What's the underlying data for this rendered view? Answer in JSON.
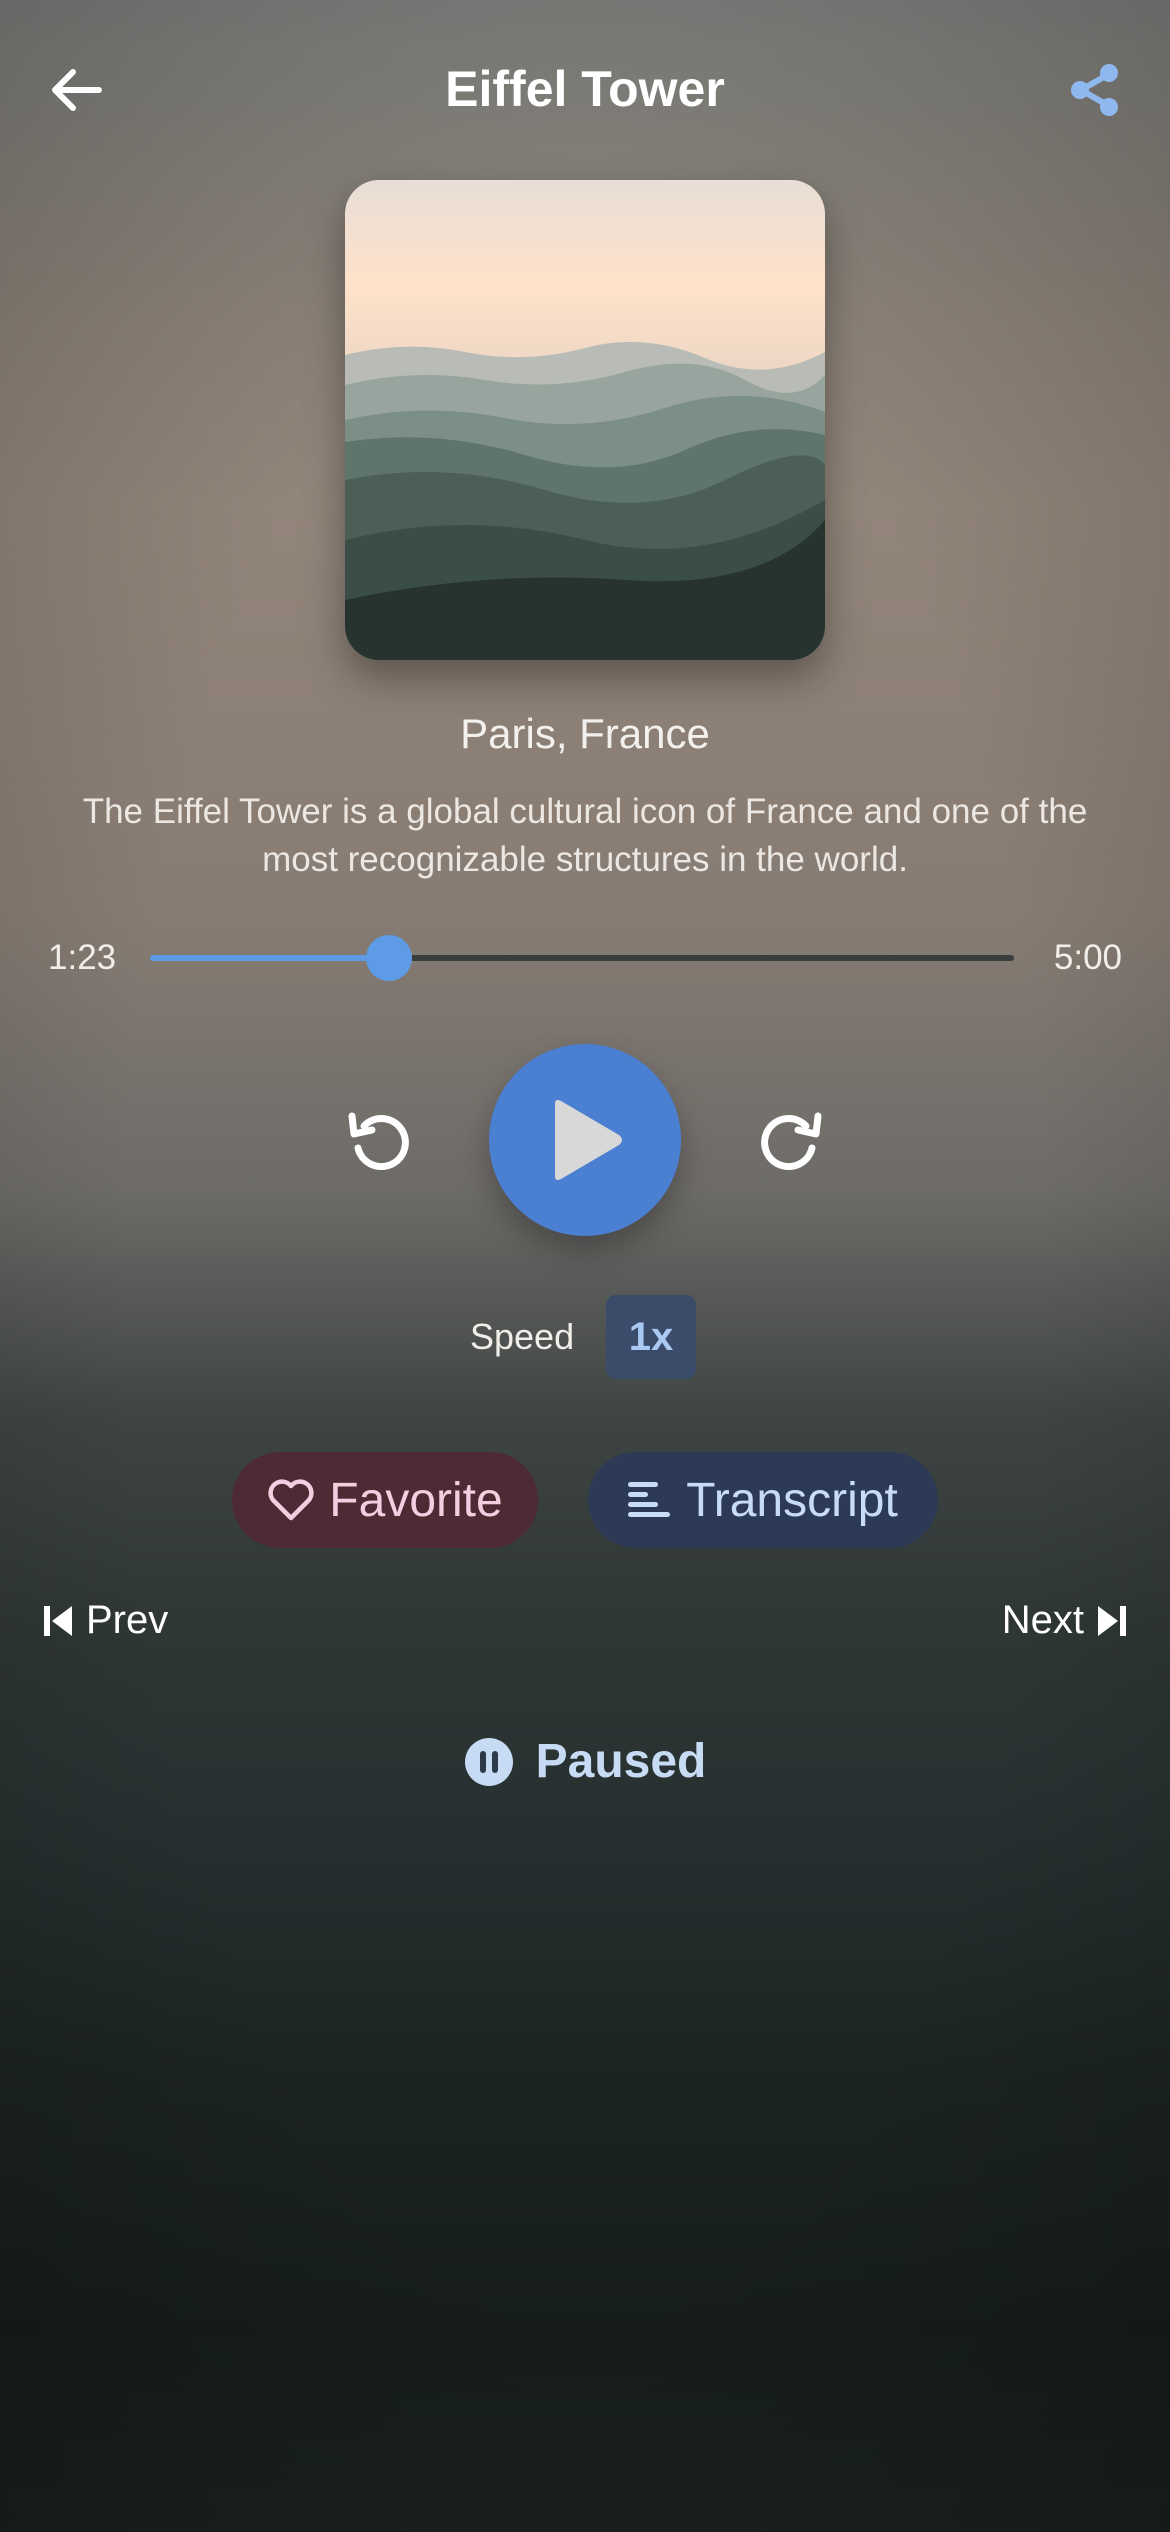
{
  "header": {
    "title": "Eiffel Tower",
    "back_icon": "arrow-left-icon",
    "share_icon": "share-icon"
  },
  "artwork": {
    "alt": "Misty mountain ranges at sunset"
  },
  "track": {
    "location": "Paris, France",
    "description": "The Eiffel Tower is a global cultural icon of France and one of the most recognizable structures in the world."
  },
  "progress": {
    "current": "1:23",
    "total": "5:00",
    "fraction": 0.277
  },
  "controls": {
    "rewind_icon": "rewind-icon",
    "play_icon": "play-icon",
    "forward_icon": "forward-icon"
  },
  "speed": {
    "label": "Speed",
    "value": "1x"
  },
  "actions": {
    "favorite_label": "Favorite",
    "transcript_label": "Transcript"
  },
  "navigation": {
    "prev_label": "Prev",
    "next_label": "Next"
  },
  "status": {
    "label": "Paused",
    "icon": "pause-circle-icon"
  },
  "colors": {
    "accent": "#4b7fd2",
    "slider": "#5e9be6",
    "favorite_bg": "#4d2a34",
    "transcript_bg": "#2c3a55"
  }
}
